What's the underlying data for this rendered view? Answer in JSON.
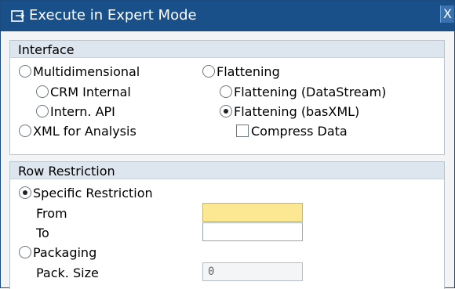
{
  "window": {
    "title": "Execute in Expert Mode",
    "close_label": "X"
  },
  "interface": {
    "title": "Interface",
    "multidimensional": "Multidimensional",
    "crm_internal": "CRM Internal",
    "intern_api": "Intern. API",
    "xml_for_analysis": "XML for Analysis",
    "flattening": "Flattening",
    "flattening_datastream": "Flattening (DataStream)",
    "flattening_basxml": "Flattening (basXML)",
    "compress_data": "Compress Data",
    "selected": "flattening_basxml"
  },
  "row_restriction": {
    "title": "Row Restriction",
    "specific_restriction": "Specific Restriction",
    "from_label": "From",
    "from_value": "",
    "to_label": "To",
    "to_value": "",
    "packaging": "Packaging",
    "pack_size_label": "Pack. Size",
    "pack_size_value": "0",
    "selected": "specific_restriction"
  },
  "colors": {
    "titlebar": "#19508a",
    "highlight_field": "#fce793"
  }
}
